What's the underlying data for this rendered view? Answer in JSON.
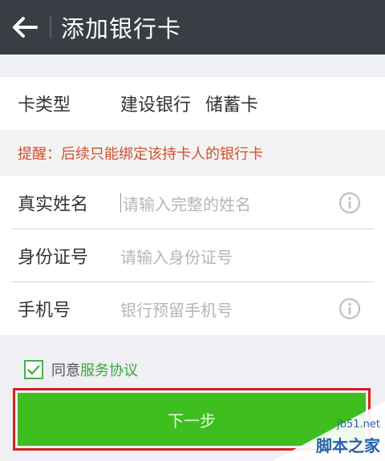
{
  "header": {
    "title": "添加银行卡",
    "back_icon": "arrow-left-icon"
  },
  "card_type": {
    "label": "卡类型",
    "bank": "建设银行",
    "kind": "储蓄卡"
  },
  "reminder": "提醒：后续只能绑定该持卡人的银行卡",
  "form": {
    "name": {
      "label": "真实姓名",
      "placeholder": "请输入完整的姓名"
    },
    "id": {
      "label": "身份证号",
      "placeholder": "请输入身份证号"
    },
    "phone": {
      "label": "手机号",
      "placeholder": "银行预留手机号"
    }
  },
  "agreement": {
    "checked": true,
    "prefix": "同意",
    "link": "服务协议"
  },
  "next_button": {
    "label": "下一步"
  },
  "watermark": {
    "url": "jb51.net",
    "name": "脚本之家"
  },
  "colors": {
    "header_bg": "#383e44",
    "reminder_text": "#d14f2c",
    "button_bg": "#3fbe1f",
    "highlight_border": "#d42020",
    "link_green": "#3aa83a"
  }
}
